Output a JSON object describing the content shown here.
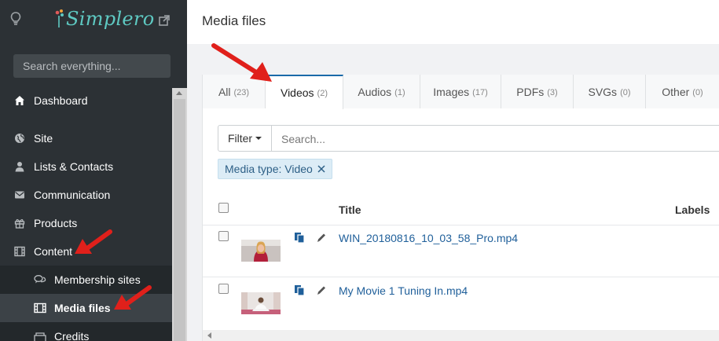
{
  "app": {
    "logo_text": "Simplero"
  },
  "sidebar": {
    "search_placeholder": "Search everything...",
    "items": [
      {
        "label": "Dashboard"
      },
      {
        "label": "Site"
      },
      {
        "label": "Lists & Contacts"
      },
      {
        "label": "Communication"
      },
      {
        "label": "Products"
      },
      {
        "label": "Content"
      }
    ],
    "sub_items": [
      {
        "label": "Membership sites"
      },
      {
        "label": "Media files"
      },
      {
        "label": "Credits"
      }
    ]
  },
  "page": {
    "title": "Media files"
  },
  "tabs": [
    {
      "label": "All",
      "count": "(23)"
    },
    {
      "label": "Videos",
      "count": "(2)"
    },
    {
      "label": "Audios",
      "count": "(1)"
    },
    {
      "label": "Images",
      "count": "(17)"
    },
    {
      "label": "PDFs",
      "count": "(3)"
    },
    {
      "label": "SVGs",
      "count": "(0)"
    },
    {
      "label": "Other",
      "count": "(0)"
    }
  ],
  "filter": {
    "button_label": "Filter",
    "search_placeholder": "Search...",
    "chip": "Media type: Video"
  },
  "table": {
    "headers": {
      "title": "Title",
      "labels": "Labels"
    },
    "rows": [
      {
        "title": "WIN_20180816_10_03_58_Pro.mp4"
      },
      {
        "title": "My Movie 1 Tuning In.mp4"
      }
    ]
  },
  "colors": {
    "sidebar_bg": "#2c3135",
    "accent": "#1a6aa8",
    "link": "#1f5f9a",
    "logo": "#5ec9c2",
    "annotation_arrow": "#e0201b"
  }
}
